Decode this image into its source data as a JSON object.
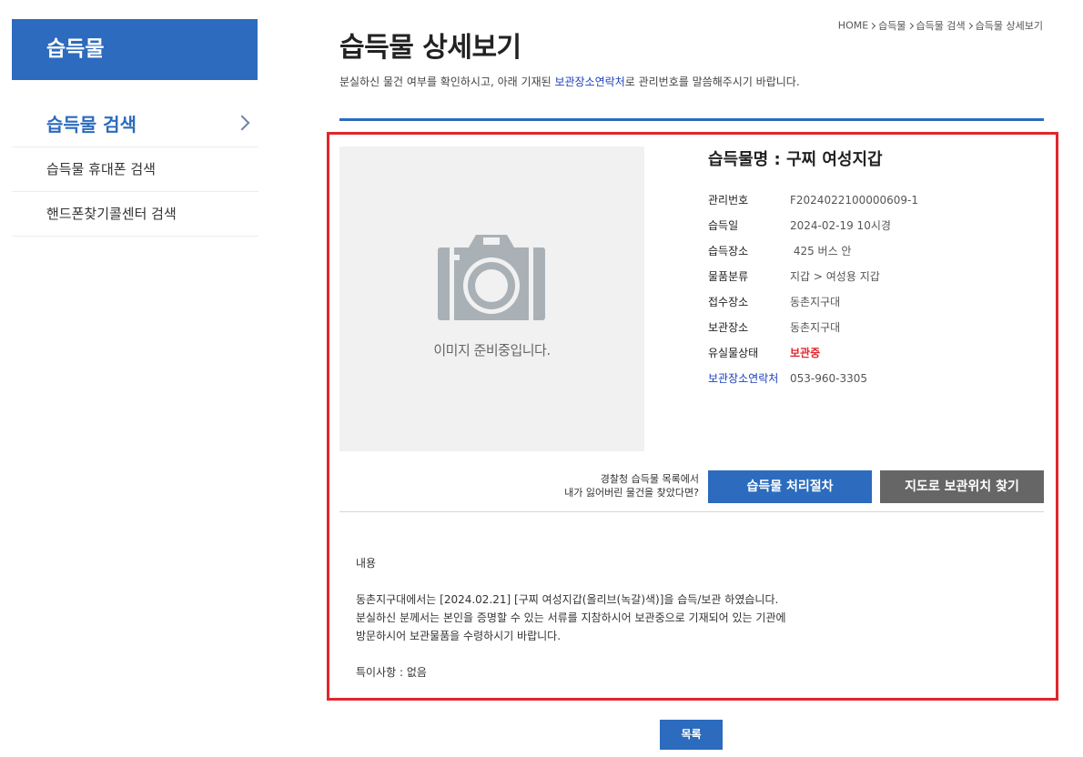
{
  "sidebar": {
    "title": "습득물",
    "items": [
      {
        "label": "습득물 검색"
      },
      {
        "label": "습득물 휴대폰 검색"
      },
      {
        "label": "핸드폰찾기콜센터 검색"
      }
    ]
  },
  "breadcrumb": [
    "HOME",
    "습득물",
    "습득물 검색",
    "습득물 상세보기"
  ],
  "page": {
    "title": "습득물 상세보기",
    "desc_before": "분실하신 물건 여부를 확인하시고, 아래 기재된 ",
    "desc_link": "보관장소연락처",
    "desc_after": "로 관리번호를 말씀해주시기 바랍니다."
  },
  "photo": {
    "caption": "이미지 준비중입니다.",
    "icon": "camera-placeholder-icon"
  },
  "item": {
    "name": "습득물명 : 구찌 여성지갑",
    "fields": [
      {
        "label": "관리번호",
        "value": "F2024022100000609-1"
      },
      {
        "label": "습득일",
        "value": "2024-02-19 10시경"
      },
      {
        "label": "습득장소",
        "value": " 425 버스 안"
      },
      {
        "label": "물품분류",
        "value": "지갑 > 여성용 지갑"
      },
      {
        "label": "접수장소",
        "value": "동촌지구대"
      },
      {
        "label": "보관장소",
        "value": "동촌지구대"
      },
      {
        "label": "유실물상태",
        "value": "보관중"
      },
      {
        "label": "보관장소연락처",
        "value": "053-960-3305"
      }
    ]
  },
  "guide": {
    "line1": "경찰청 습득물 목록에서",
    "line2": "내가 잃어버린 물건을 찾았다면?"
  },
  "buttons": {
    "procedure": "습득물 처리절차",
    "map": "지도로 보관위치 찾기",
    "list": "목록"
  },
  "content": {
    "heading": "내용",
    "line1": "동촌지구대에서는 [2024.02.21] [구찌 여성지갑(올리브(녹갈)색)]을 습득/보관 하였습니다.",
    "line2": "분실하신 분께서는 본인을 증명할 수 있는 서류를 지참하시어 보관중으로 기재되어 있는 기관에",
    "line3": "방문하시어 보관물품을 수령하시기 바랍니다.",
    "notes": "특이사항 : 없음"
  },
  "colors": {
    "accent": "#2c6bbd",
    "highlight_border": "#e0262c",
    "status": "#e0262c",
    "link": "#1a3fbf"
  }
}
